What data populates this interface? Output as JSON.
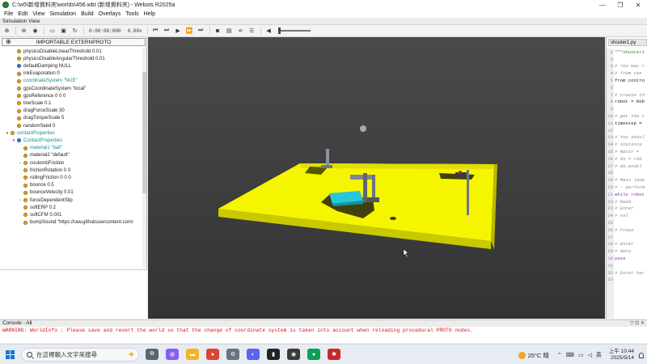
{
  "window": {
    "title": "C:\\w5\\新增資料夾\\worlds\\456.wbt (新增資料夾) - Webots R2025a",
    "minimize": "—",
    "maximize": "❐",
    "close": "✕"
  },
  "menu": [
    "File",
    "Edit",
    "View",
    "Simulation",
    "Build",
    "Overlays",
    "Tools",
    "Help"
  ],
  "simulation_view_label": "Simulation View",
  "toolbar": {
    "time": "0:00:00:000",
    "speed": "0.00x"
  },
  "scene_tree": {
    "import_button": "IMPORTABLE EXTERNPROTO",
    "rows": [
      {
        "label": "physicsDisableLinearThreshold 0.01",
        "kind": "field",
        "indent": 1
      },
      {
        "label": "physicsDisableAngularThreshold 0.01",
        "kind": "field",
        "indent": 1
      },
      {
        "label": "defaultDamping NULL",
        "kind": "node",
        "indent": 1
      },
      {
        "label": "inkEvaporation 0",
        "kind": "field",
        "indent": 1
      },
      {
        "label": "coordinateSystem \"NUE\"",
        "kind": "field",
        "indent": 1,
        "teal": true
      },
      {
        "label": "gpsCoordinateSystem \"local\"",
        "kind": "field",
        "indent": 1
      },
      {
        "label": "gpsReference 0 0 0",
        "kind": "field",
        "indent": 1
      },
      {
        "label": "lineScale 0.1",
        "kind": "field",
        "indent": 1
      },
      {
        "label": "dragForceScale 30",
        "kind": "field",
        "indent": 1
      },
      {
        "label": "dragTorqueScale 5",
        "kind": "field",
        "indent": 1
      },
      {
        "label": "randomSeed 0",
        "kind": "field",
        "indent": 1
      },
      {
        "label": "contactProperties",
        "kind": "field",
        "indent": 0,
        "arrow": "▾",
        "teal": true
      },
      {
        "label": "ContactProperties",
        "kind": "node",
        "indent": 1,
        "arrow": "▾",
        "teal": true
      },
      {
        "label": "material1 \"ball\"",
        "kind": "field",
        "indent": 2,
        "teal": true
      },
      {
        "label": "material2 \"default\"",
        "kind": "field",
        "indent": 2
      },
      {
        "label": "coulombFriction",
        "kind": "field",
        "indent": 2,
        "arrow": "›"
      },
      {
        "label": "frictionRotation 0 0",
        "kind": "field",
        "indent": 2
      },
      {
        "label": "rollingFriction 0 0 0",
        "kind": "field",
        "indent": 2
      },
      {
        "label": "bounce 0.5",
        "kind": "field",
        "indent": 2
      },
      {
        "label": "bounceVelocity 0.01",
        "kind": "field",
        "indent": 2
      },
      {
        "label": "forceDependentSlip",
        "kind": "field",
        "indent": 2,
        "arrow": "›"
      },
      {
        "label": "softERP 0.2",
        "kind": "field",
        "indent": 2
      },
      {
        "label": "softCFM 0.001",
        "kind": "field",
        "indent": 2
      },
      {
        "label": "bumpSound \"https://raw.githubusercontent.com/",
        "kind": "field",
        "indent": 2
      }
    ]
  },
  "editor": {
    "tab": "shooter1.py",
    "lines": [
      {
        "n": "1",
        "t": "\"\"\"shooter1",
        "c": "str"
      },
      {
        "n": "2",
        "t": "",
        "c": "txt"
      },
      {
        "n": "3",
        "t": "# You may r",
        "c": "cmt"
      },
      {
        "n": "4",
        "t": "#  from con",
        "c": "cmt"
      },
      {
        "n": "5",
        "t": "from contro",
        "c": "txt"
      },
      {
        "n": "6",
        "t": "",
        "c": "txt"
      },
      {
        "n": "7",
        "t": "# create th",
        "c": "cmt"
      },
      {
        "n": "8",
        "t": "robot = Rob",
        "c": "txt"
      },
      {
        "n": "9",
        "t": "",
        "c": "txt"
      },
      {
        "n": "10",
        "t": "# get the t",
        "c": "cmt"
      },
      {
        "n": "11",
        "t": "timestep =",
        "c": "txt"
      },
      {
        "n": "12",
        "t": "",
        "c": "txt"
      },
      {
        "n": "13",
        "t": "# You shoul",
        "c": "cmt"
      },
      {
        "n": "14",
        "t": "# instance",
        "c": "cmt"
      },
      {
        "n": "15",
        "t": "#  motor =",
        "c": "cmt"
      },
      {
        "n": "16",
        "t": "#  ds = rob",
        "c": "cmt"
      },
      {
        "n": "17",
        "t": "#  ds.enabl",
        "c": "cmt"
      },
      {
        "n": "18",
        "t": "",
        "c": "txt"
      },
      {
        "n": "19",
        "t": "# Main loop",
        "c": "cmt"
      },
      {
        "n": "20",
        "t": "# - perform",
        "c": "cmt"
      },
      {
        "n": "21",
        "t": "while robot",
        "c": "kw"
      },
      {
        "n": "22",
        "t": "  # Read",
        "c": "cmt"
      },
      {
        "n": "23",
        "t": "  # Enter",
        "c": "cmt"
      },
      {
        "n": "24",
        "t": "  #  val",
        "c": "cmt"
      },
      {
        "n": "25",
        "t": "",
        "c": "txt"
      },
      {
        "n": "26",
        "t": "  # Proce",
        "c": "cmt"
      },
      {
        "n": "27",
        "t": "",
        "c": "txt"
      },
      {
        "n": "28",
        "t": "  # Enter",
        "c": "cmt"
      },
      {
        "n": "29",
        "t": "  #  moto",
        "c": "cmt"
      },
      {
        "n": "30",
        "t": "  pass",
        "c": "kw"
      },
      {
        "n": "31",
        "t": "",
        "c": "txt"
      },
      {
        "n": "32",
        "t": "# Enter her",
        "c": "cmt"
      },
      {
        "n": "33",
        "t": "",
        "c": "txt"
      }
    ]
  },
  "console": {
    "header": "Console - All",
    "controls": "▽ ⊡ ✕",
    "message": "WARNING: WorldInfo : Please save and revert the world so that the change of coordinate system is taken into account when reloading procedural PROTO nodes."
  },
  "taskbar": {
    "search_placeholder": "在這裡輸入文字來搜尋",
    "weather": "25°C 晴",
    "tray_lang": "英",
    "time": "上午 10:44",
    "date": "2025/5/14"
  },
  "colors": {
    "arena_floor": "#f6f500",
    "robot_cyan": "#27c6d8",
    "warning": "#d11111"
  }
}
